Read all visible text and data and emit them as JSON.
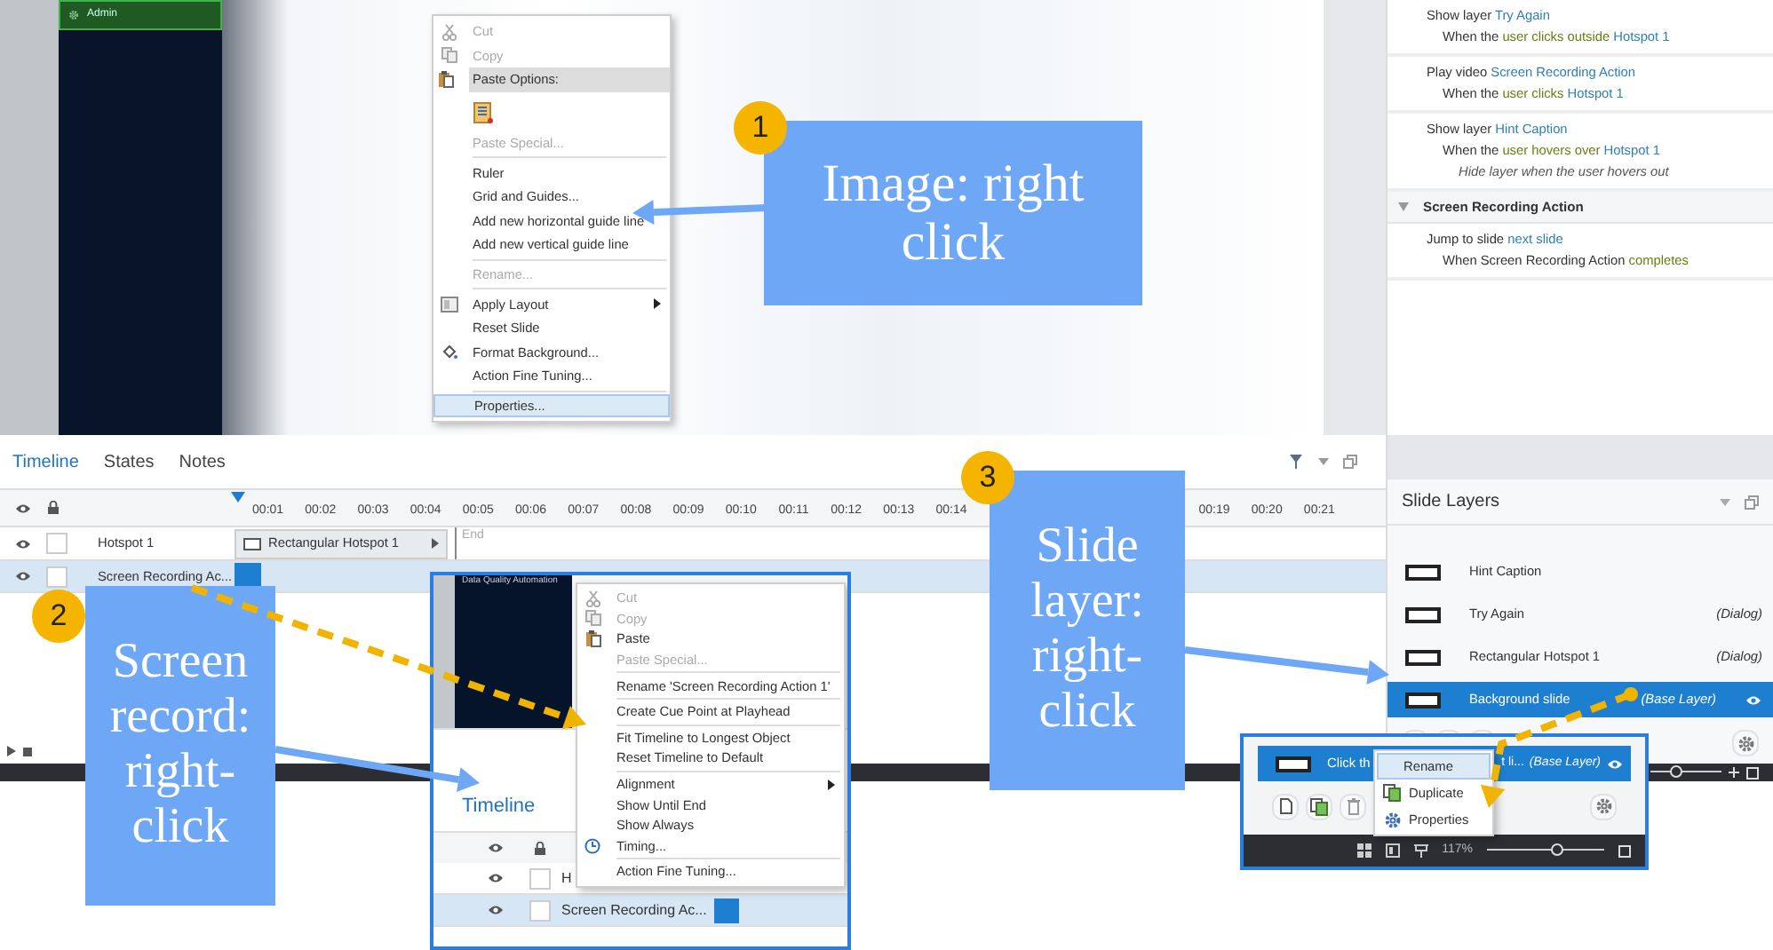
{
  "stage": {
    "sidebar_item": "Admin"
  },
  "slide_menu": [
    {
      "kind": "item",
      "text": "Cut",
      "disabled": true,
      "selected": false,
      "submenu": false
    },
    {
      "kind": "item",
      "text": "Copy",
      "disabled": true,
      "selected": false,
      "submenu": false
    },
    {
      "kind": "header",
      "text": "Paste Options:"
    },
    {
      "kind": "paste_option"
    },
    {
      "kind": "item",
      "text": "Paste Special...",
      "disabled": true,
      "selected": false,
      "submenu": false
    },
    {
      "kind": "separator"
    },
    {
      "kind": "item",
      "text": "Ruler",
      "disabled": false,
      "selected": false,
      "submenu": false
    },
    {
      "kind": "item",
      "text": "Grid and Guides...",
      "disabled": false,
      "selected": false,
      "submenu": false
    },
    {
      "kind": "item",
      "text": "Add new horizontal guide line",
      "disabled": false,
      "selected": false,
      "submenu": false
    },
    {
      "kind": "item",
      "text": "Add new vertical guide line",
      "disabled": false,
      "selected": false,
      "submenu": false
    },
    {
      "kind": "separator"
    },
    {
      "kind": "item",
      "text": "Rename...",
      "disabled": true,
      "selected": false,
      "submenu": false
    },
    {
      "kind": "separator"
    },
    {
      "kind": "item",
      "text": "Apply Layout",
      "disabled": false,
      "selected": false,
      "submenu": true
    },
    {
      "kind": "item",
      "text": "Reset Slide",
      "disabled": false,
      "selected": false,
      "submenu": false
    },
    {
      "kind": "item",
      "text": "Format Background...",
      "disabled": false,
      "selected": false,
      "submenu": false
    },
    {
      "kind": "item",
      "text": "Action Fine Tuning...",
      "disabled": false,
      "selected": false,
      "submenu": false
    },
    {
      "kind": "separator"
    },
    {
      "kind": "item",
      "text": "Properties...",
      "disabled": false,
      "selected": true,
      "submenu": false
    }
  ],
  "actions": [
    {
      "kind": "action",
      "lines": [
        [
          {
            "text": "Show layer ",
            "kind": "plain"
          },
          {
            "text": "Try Again",
            "kind": "object"
          }
        ],
        [
          {
            "text": "When the ",
            "kind": "plain"
          },
          {
            "text": "user clicks outside ",
            "kind": "event"
          },
          {
            "text": "Hotspot 1",
            "kind": "object"
          }
        ]
      ]
    },
    {
      "kind": "action",
      "lines": [
        [
          {
            "text": "Play video ",
            "kind": "plain"
          },
          {
            "text": "Screen Recording Action",
            "kind": "object"
          }
        ],
        [
          {
            "text": "When the ",
            "kind": "plain"
          },
          {
            "text": "user clicks ",
            "kind": "event"
          },
          {
            "text": "Hotspot 1",
            "kind": "object"
          }
        ]
      ]
    },
    {
      "kind": "action",
      "lines": [
        [
          {
            "text": "Show layer ",
            "kind": "plain"
          },
          {
            "text": "Hint Caption",
            "kind": "object"
          }
        ],
        [
          {
            "text": "When the ",
            "kind": "plain"
          },
          {
            "text": "user hovers over ",
            "kind": "event"
          },
          {
            "text": "Hotspot 1",
            "kind": "object"
          }
        ],
        [
          {
            "text": "Hide layer when the user hovers out",
            "kind": "note"
          }
        ]
      ]
    },
    {
      "kind": "group",
      "text": "Screen Recording Action",
      "expanded": true
    },
    {
      "kind": "action",
      "lines": [
        [
          {
            "text": "Jump to slide ",
            "kind": "plain"
          },
          {
            "text": "next slide",
            "kind": "object"
          }
        ],
        [
          {
            "text": "When Screen Recording Action ",
            "kind": "plain"
          },
          {
            "text": "completes",
            "kind": "event"
          }
        ]
      ]
    }
  ],
  "timeline": {
    "tabs": [
      {
        "label": "Timeline",
        "selected": true
      },
      {
        "label": "States",
        "selected": false
      },
      {
        "label": "Notes",
        "selected": false
      }
    ],
    "ticks": [
      "00:01",
      "00:02",
      "00:03",
      "00:04",
      "00:05",
      "00:06",
      "00:07",
      "00:08",
      "00:09",
      "00:10",
      "00:11",
      "00:12",
      "00:13",
      "00:14"
    ],
    "ticks_after": [
      "00:19",
      "00:20",
      "00:21"
    ],
    "end_label": "End",
    "rows": [
      {
        "name": "Hotspot 1",
        "selected": false,
        "locked": false,
        "bar": "Rectangular Hotspot 1"
      },
      {
        "name": "Screen Recording Ac...",
        "selected": true,
        "locked": false
      }
    ]
  },
  "slide_layers": {
    "title": "Slide Layers",
    "layers": [
      {
        "name": "Hint Caption",
        "selected": false
      },
      {
        "name": "Try Again",
        "tag": "(Dialog)",
        "selected": false
      },
      {
        "name": "Rectangular Hotspot 1",
        "tag": "(Dialog)",
        "selected": false
      },
      {
        "name": "Background slide",
        "tag": "(Base Layer)",
        "selected": true
      }
    ]
  },
  "status_bar": {
    "zoom_slider": {
      "level": 0.35
    }
  },
  "callouts": [
    {
      "number": "1",
      "text": "Image:  right click"
    },
    {
      "number": "2",
      "text": "Screen record: right-click"
    },
    {
      "number": "3",
      "text": "Slide layer: right-click"
    }
  ],
  "inset_timeline": {
    "image_title": "Data Quality Automation",
    "tab": "Timeline",
    "rows": [
      {
        "name": "H",
        "selected": false,
        "locked": false
      },
      {
        "name": "Screen Recording Ac...",
        "selected": true,
        "locked": false
      }
    ],
    "menu": [
      {
        "kind": "item",
        "text": "Cut",
        "disabled": true,
        "submenu": false
      },
      {
        "kind": "item",
        "text": "Copy",
        "disabled": true,
        "submenu": false
      },
      {
        "kind": "item",
        "text": "Paste",
        "disabled": false,
        "submenu": false
      },
      {
        "kind": "item",
        "text": "Paste Special...",
        "disabled": true,
        "submenu": false
      },
      {
        "kind": "separator"
      },
      {
        "kind": "item",
        "text": "Rename 'Screen Recording Action 1'",
        "disabled": false,
        "submenu": false
      },
      {
        "kind": "separator"
      },
      {
        "kind": "item",
        "text": "Create Cue Point at Playhead",
        "disabled": false,
        "submenu": false
      },
      {
        "kind": "separator"
      },
      {
        "kind": "item",
        "text": "Fit Timeline to Longest Object",
        "disabled": false,
        "submenu": false
      },
      {
        "kind": "item",
        "text": "Reset Timeline to Default",
        "disabled": false,
        "submenu": false
      },
      {
        "kind": "separator"
      },
      {
        "kind": "item",
        "text": "Alignment",
        "disabled": false,
        "submenu": true
      },
      {
        "kind": "item",
        "text": "Show Until End",
        "disabled": false,
        "submenu": false
      },
      {
        "kind": "item",
        "text": "Show Always",
        "disabled": false,
        "submenu": false
      },
      {
        "kind": "item",
        "text": "Timing...",
        "disabled": false,
        "submenu": false
      },
      {
        "kind": "separator"
      },
      {
        "kind": "item",
        "text": "Action Fine Tuning...",
        "disabled": false,
        "submenu": false
      }
    ]
  },
  "inset_layers": {
    "row_start": "Click th",
    "row_end": "t li...",
    "tag": "(Base Layer)",
    "zoom": "117%",
    "zoom_slider": {
      "level": 0.6
    },
    "menu": [
      {
        "text": "Rename",
        "selected": true
      },
      {
        "text": "Duplicate",
        "selected": false
      },
      {
        "text": "Properties",
        "selected": false
      }
    ]
  }
}
